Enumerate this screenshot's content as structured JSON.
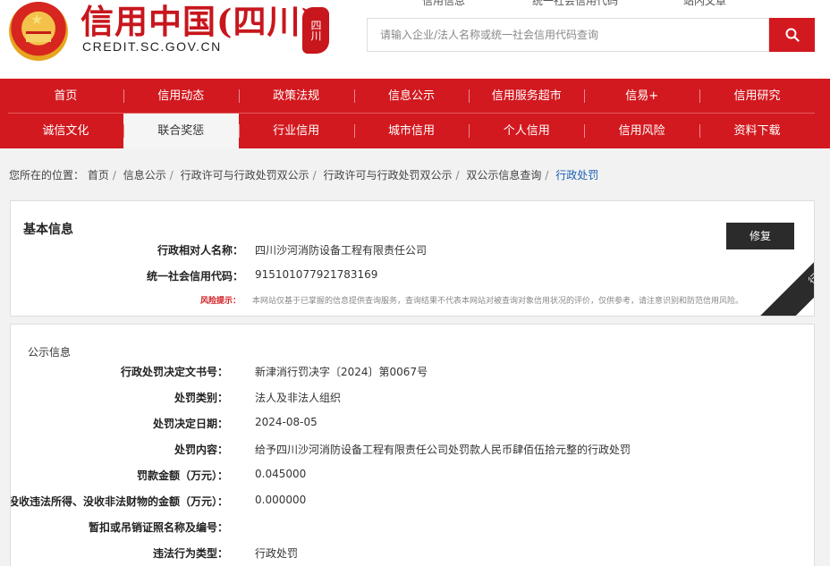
{
  "header": {
    "logo_cn": "信用中国(四川)",
    "logo_en": "CREDIT.SC.GOV.CN",
    "seal_text": "四川",
    "top_links": [
      "信用信息",
      "统一社会信用代码",
      "站内文章"
    ],
    "search_placeholder": "请输入企业/法人名称或统一社会信用代码查询"
  },
  "nav": {
    "row1": [
      "首页",
      "信用动态",
      "政策法规",
      "信息公示",
      "信用服务超市",
      "信易+",
      "信用研究"
    ],
    "row2": [
      "诚信文化",
      "联合奖惩",
      "行业信用",
      "城市信用",
      "个人信用",
      "信用风险",
      "资料下载"
    ],
    "active": "联合奖惩"
  },
  "breadcrumb": {
    "prefix": "您所在的位置：",
    "items": [
      "首页",
      "信息公示",
      "行政许可与行政处罚双公示",
      "行政许可与行政处罚双公示",
      "双公示信息查询",
      "行政处罚"
    ]
  },
  "basic_info": {
    "title": "基本信息",
    "fields": [
      {
        "label": "行政相对人名称：",
        "value": "四川沙河消防设备工程有限责任公司"
      },
      {
        "label": "统一社会信用代码：",
        "value": "915101077921783169"
      }
    ],
    "repair_label": "修复",
    "ribbon_text": "行政处罚",
    "risk_label": "风险提示：",
    "risk_text": "本网站仅基于已掌握的信息提供查询服务，查询结果不代表本网站对被查询对象信用状况的评价，仅供参考，请注意识别和防范信用风险。"
  },
  "public_info": {
    "title": "公示信息",
    "fields": [
      {
        "label": "行政处罚决定文书号：",
        "value": "新津消行罚决字〔2024〕第0067号"
      },
      {
        "label": "处罚类别：",
        "value": "法人及非法人组织"
      },
      {
        "label": "处罚决定日期：",
        "value": "2024-08-05"
      },
      {
        "label": "处罚内容：",
        "value": "给予四川沙河消防设备工程有限责任公司处罚款人民币肆佰伍拾元整的行政处罚"
      },
      {
        "label": "罚款金额（万元）：",
        "value": "0.045000"
      },
      {
        "label": "没收违法所得、没收非法财物的金额（万元）：",
        "value": "0.000000"
      },
      {
        "label": "暂扣或吊销证照名称及编号：",
        "value": ""
      },
      {
        "label": "违法行为类型：",
        "value": "行政处罚"
      }
    ]
  },
  "colors": {
    "brand_red": "#d2191f",
    "dark": "#2b2b2b",
    "link_blue": "#1a5fb4"
  }
}
